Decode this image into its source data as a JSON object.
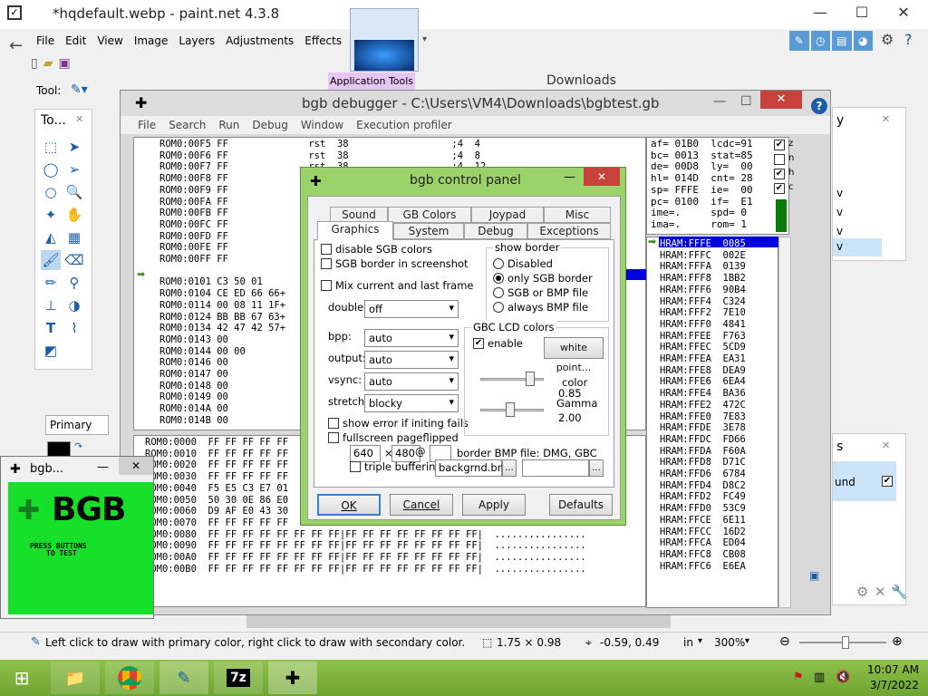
{
  "paintnet": {
    "title": "*hqdefault.webp - paint.net 4.3.8",
    "menu": [
      "File",
      "Edit",
      "View",
      "Image",
      "Layers",
      "Adjustments",
      "Effects"
    ],
    "tool_label": "Tool:",
    "tools_panel_title": "To...",
    "primary_label": "Primary",
    "status_hint": "Left click to draw with primary color, right click to draw with secondary color.",
    "selection_size": "1.75 × 0.98",
    "cursor_pos": "-0.59, 0.49",
    "units": "in",
    "zoom": "300%",
    "app_tools_tab": "Application Tools",
    "downloads_title": "Downloads",
    "right_panel_letter": "y",
    "right_panel_v": "v",
    "right_panel_s": "s",
    "right_panel_und": "und"
  },
  "debugger": {
    "title": "bgb debugger - C:\\Users\\VM4\\Downloads\\bgbtest.gb",
    "menu": [
      "File",
      "Search",
      "Run",
      "Debug",
      "Window",
      "Execution profiler"
    ],
    "disasm": [
      "ROM0:00F5 FF              rst  38                  ;4  4",
      "ROM0:00F6 FF              rst  38                  ;4  8",
      "ROM0:00F7 FF              rst  38                  ;4  12",
      "ROM0:00F8 FF",
      "ROM0:00F9 FF",
      "ROM0:00FA FF",
      "ROM0:00FB FF",
      "ROM0:00FC FF",
      "ROM0:00FD FF",
      "ROM0:00FE FF",
      "ROM0:00FF FF",
      "ROM0:0100 00",
      "ROM0:0101 C3 50 01",
      "ROM0:0104 CE ED 66 66+",
      "ROM0:0114 00 08 11 1F+",
      "ROM0:0124 BB BB 67 63+",
      "ROM0:0134 42 47 42 57+",
      "ROM0:0143 00",
      "ROM0:0144 00 00",
      "ROM0:0146 00",
      "ROM0:0147 00",
      "ROM0:0148 00",
      "ROM0:0149 00",
      "ROM0:014A 00",
      "ROM0:014B 00"
    ],
    "memdump": [
      "ROM0:0000  FF FF FF FF FF",
      "ROM0:0010  FF FF FF FF FF",
      "ROM0:0020  FF FF FF FF FF",
      "ROM0:0030  FF FF FF FF FF",
      "ROM0:0040  F5 E5 C3 E7 01",
      "ROM0:0050  50 30 0E 86 E0",
      "ROM0:0060  D9 AF E0 43 30",
      "ROM0:0070  FF FF FF FF FF",
      "ROM0:0080  FF FF FF FF FF FF FF FF|FF FF FF FF FF FF FF FF|  ................",
      "ROM0:0090  FF FF FF FF FF FF FF FF|FF FF FF FF FF FF FF FF|  ................",
      "ROM0:00A0  FF FF FF FF FF FF FF FF|FF FF FF FF FF FF FF FF|  ................",
      "ROM0:00B0  FF FF FF FF FF FF FF FF|FF FF FF FF FF FF FF FF|  ................"
    ],
    "registers": [
      "af= 01B0  lcdc=91",
      "bc= 0013  stat=85",
      "de= 00D8  ly=  00",
      "hl= 014D  cnt= 28",
      "sp= FFFE  ie=  00",
      "pc= 0100  if=  E1",
      "ime=.     spd= 0",
      "ima=.     rom= 1"
    ],
    "flags": [
      "z",
      "n",
      "h",
      "c"
    ],
    "stack": [
      "HRAM:FFFE  0085",
      "HRAM:FFFC  002E",
      "HRAM:FFFA  0139",
      "HRAM:FFF8  1BB2",
      "HRAM:FFF6  90B4",
      "HRAM:FFF4  C324",
      "HRAM:FFF2  7E10",
      "HRAM:FFF0  4841",
      "HRAM:FFEE  F763",
      "HRAM:FFEC  5CD9",
      "HRAM:FFEA  EA31",
      "HRAM:FFE8  DEA9",
      "HRAM:FFE6  6EA4",
      "HRAM:FFE4  BA36",
      "HRAM:FFE2  472C",
      "HRAM:FFE0  7E83",
      "HRAM:FFDE  3E78",
      "HRAM:FFDC  FD66",
      "HRAM:FFDA  F60A",
      "HRAM:FFD8  D71C",
      "HRAM:FFD6  6784",
      "HRAM:FFD4  D8C2",
      "HRAM:FFD2  FC49",
      "HRAM:FFD0  53C9",
      "HRAM:FFCE  6E11",
      "HRAM:FFCC  16D2",
      "HRAM:FFCA  ED04",
      "HRAM:FFC8  CB08",
      "HRAM:FFC6  E6EA"
    ]
  },
  "control_panel": {
    "title": "bgb control panel",
    "tabs_row1": [
      "Sound",
      "GB Colors",
      "Joypad",
      "Misc"
    ],
    "tabs_row2": [
      "Graphics",
      "System",
      "Debug",
      "Exceptions"
    ],
    "disable_sgb": "disable SGB colors",
    "sgb_border_screenshot": "SGB border in screenshot",
    "mix_frames": "Mix current and last frame",
    "doubler_label": "doubler:",
    "doubler_value": "off",
    "bpp_label": "bpp:",
    "bpp_value": "auto",
    "output_label": "output:",
    "output_value": "auto",
    "vsync_label": "vsync:",
    "vsync_value": "auto",
    "stretch_label": "stretch:",
    "stretch_value": "blocky",
    "show_error": "show error if initing fails",
    "fullscreen_pageflipped": "fullscreen pageflipped",
    "width": "640",
    "times": "×",
    "height": "480",
    "at": "@",
    "border_bmp": "border BMP file: DMG, GBC",
    "triple_buffering": "triple buffering",
    "bmp_file": "backgrnd.bmp",
    "browse": "...",
    "show_border_title": "show border",
    "border_options": [
      "Disabled",
      "only SGB border",
      "SGB or BMP file",
      "always BMP file"
    ],
    "lcd_title": "GBC LCD colors",
    "enable": "enable",
    "white_point": "white point...",
    "color_label": "color",
    "color_value": "0.85",
    "gamma_label": "Gamma",
    "gamma_value": "2.00",
    "ok": "OK",
    "cancel": "Cancel",
    "apply": "Apply",
    "defaults": "Defaults"
  },
  "game": {
    "title": "bgb...",
    "logo": "BGB",
    "press": "PRESS BUTTONS",
    "to_test": "TO TEST"
  },
  "taskbar": {
    "time": "10:07 AM",
    "date": "3/7/2022",
    "app_7z": "7z"
  }
}
